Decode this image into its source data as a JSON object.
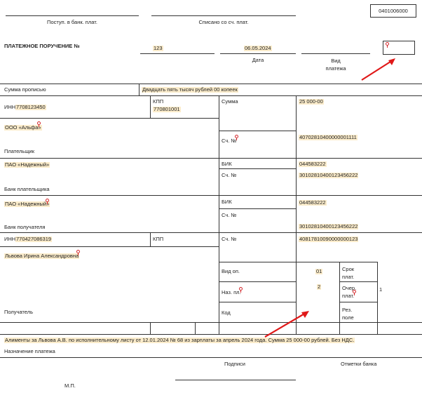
{
  "form": {
    "code": "0401006000",
    "received_label": "Поступ. в банк. плат.",
    "debited_label": "Списано со сч. плат.",
    "title": "ПЛАТЕЖНОЕ ПОРУЧЕНИЕ №",
    "number": "123",
    "date": "06.05.2024",
    "date_label": "Дата",
    "payment_type_label": "Вид\nплатежа",
    "amount_words_label": "Сумма прописью",
    "amount_words": "Двадцать пять тысяч рублей 00 копеек"
  },
  "payer": {
    "inn_label": "ИНН",
    "inn": "7708123450",
    "kpp_label": "КПП",
    "kpp": "770801001",
    "name": "ООО «Альфа»",
    "role_label": "Плательщик",
    "account_label": "Сч. №",
    "account": "40702810400000001111",
    "bank_name": "ПАО «Надежный»",
    "bank_label": "Банк плательщика",
    "bik_label": "БИК",
    "bik": "044583222",
    "corr_label": "Сч. №",
    "corr_account": "30102810400123456222"
  },
  "sum": {
    "label": "Сумма",
    "value": "25 000-00"
  },
  "payee": {
    "bank_name": "ПАО «Надежный»",
    "bank_label": "Банк получателя",
    "bik_label": "БИК",
    "bik": "044583222",
    "corr_label": "Сч. №",
    "corr_account": "30102810400123456222",
    "inn_label": "ИНН",
    "inn": "770427086319",
    "kpp_label": "КПП",
    "account_label": "Сч. №",
    "account": "40817810090000000123",
    "name": "Львова Ирина Александровна",
    "role_label": "Получатель"
  },
  "codes": {
    "op_type_label": "Вид оп.",
    "op_type": "01",
    "purpose_label": "Наз. пл.",
    "priority": "2",
    "code_label": "Код",
    "term_label": "Срок\nплат.",
    "order_label": "Очер.\nплат.",
    "order_value": "1",
    "reserve_label": "Рез.\nполе"
  },
  "purpose": {
    "text": "Алименты за Львова А.В. по исполнительному листу от 12.01.2024 № 68 из зарплаты за апрель 2024 года. Сумма 25 000-00 рублей. Без НДС.",
    "label": "Назначение платежа"
  },
  "footer": {
    "signatures_label": "Подписи",
    "bank_marks_label": "Отметки банка",
    "stamp_label": "М.П."
  },
  "colors": {
    "highlight": "#fbeccb",
    "pin": "#d2262a",
    "arrow": "#e01818"
  }
}
